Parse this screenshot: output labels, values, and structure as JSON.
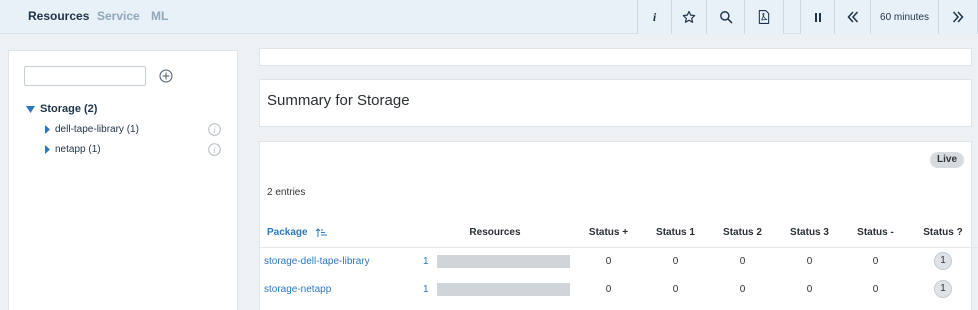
{
  "nav": {
    "tabs": [
      {
        "label": "Resources"
      },
      {
        "label": "Service"
      },
      {
        "label": "ML"
      }
    ]
  },
  "toolbar": {
    "time_range": "60 minutes"
  },
  "sidebar": {
    "filter_value": "",
    "tree": {
      "root_label": "Storage (2)",
      "children": [
        {
          "label": "dell-tape-library (1)"
        },
        {
          "label": "netapp (1)"
        }
      ]
    }
  },
  "summary": {
    "title": "Summary for Storage"
  },
  "table": {
    "live_label": "Live",
    "entries_text": "2 entries",
    "headers": [
      "Package",
      "Resources",
      "Status +",
      "Status 1",
      "Status 2",
      "Status 3",
      "Status -",
      "Status ?"
    ],
    "rows": [
      {
        "package": "storage-dell-tape-library",
        "resources": "1",
        "status_plus": "0",
        "status_1": "0",
        "status_2": "0",
        "status_3": "0",
        "status_minus": "0",
        "status_q": "1"
      },
      {
        "package": "storage-netapp",
        "resources": "1",
        "status_plus": "0",
        "status_1": "0",
        "status_2": "0",
        "status_3": "0",
        "status_minus": "0",
        "status_q": "1"
      }
    ]
  },
  "colors": {
    "accent": "#2b78c2",
    "topbar": "#e8f0f8",
    "tab_active": "#1f3347",
    "tab_inactive": "#8fa6bb"
  },
  "icons": [
    "info-icon",
    "star-icon",
    "search-icon",
    "pdf-icon",
    "pause-icon",
    "double-chevron-left-icon",
    "double-chevron-right-icon",
    "plus-circle-icon",
    "caret-down-icon",
    "caret-right-icon",
    "sort-asc-icon"
  ]
}
